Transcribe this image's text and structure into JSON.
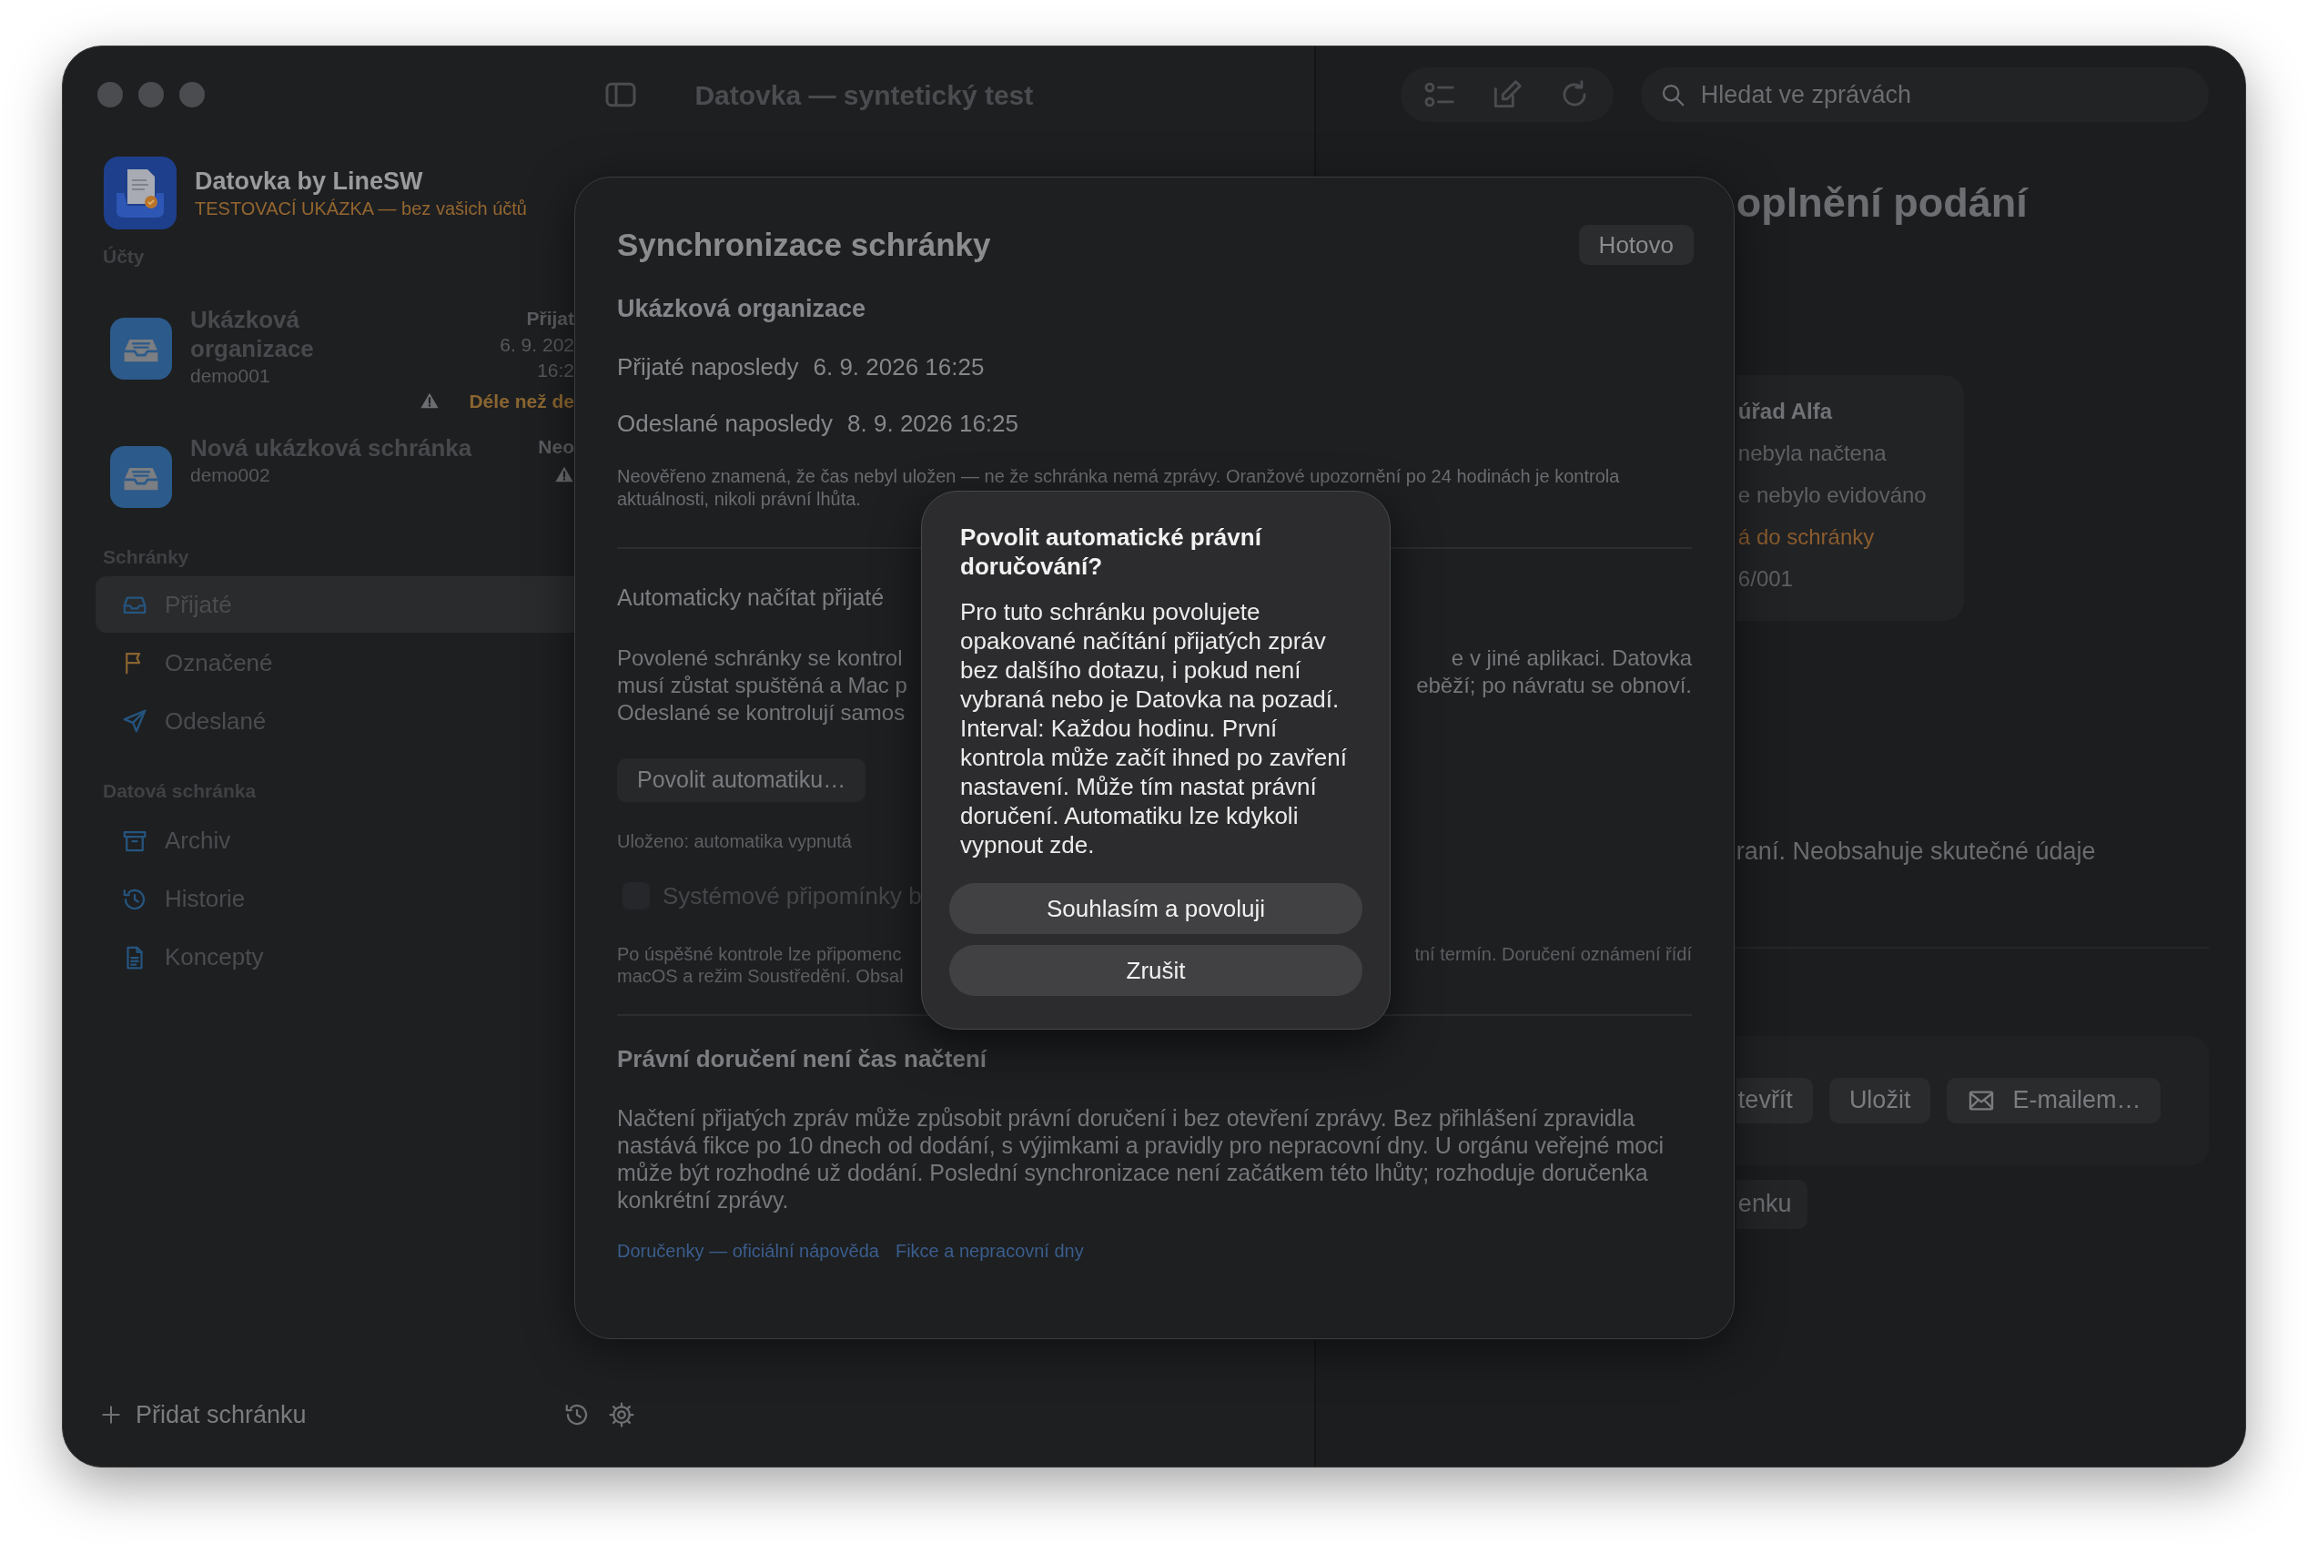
{
  "window": {
    "title": "Datovka — syntetický test"
  },
  "sidebar": {
    "app_name": "Datovka by LineSW",
    "app_subtitle": "TESTOVACÍ UKÁZKA — bez vašich účtů",
    "accounts_heading": "Účty",
    "accounts": [
      {
        "name": "Ukázková organizace",
        "box_id": "demo001",
        "status": [
          "Přijat",
          "6. 9. 202",
          "16:2"
        ],
        "warning": true,
        "warning_text": "Déle než de"
      },
      {
        "name": "Nová ukázková schránka",
        "box_id": "demo002",
        "status": [
          "Neo"
        ],
        "warning": true
      }
    ],
    "sections": [
      {
        "heading": "Schránky",
        "items": [
          {
            "label": "Přijaté",
            "selected": true
          },
          {
            "label": "Označené",
            "selected": false
          },
          {
            "label": "Odeslané",
            "selected": false
          }
        ]
      },
      {
        "heading": "Datová schránka",
        "items": [
          {
            "label": "Archiv",
            "selected": false
          },
          {
            "label": "Historie",
            "selected": false
          },
          {
            "label": "Koncepty",
            "selected": false
          }
        ]
      }
    ],
    "add_button": "Přidat schránku"
  },
  "search": {
    "placeholder": "Hledat ve zprávách"
  },
  "detail": {
    "heading": "oplnění podání",
    "card_lines": [
      {
        "text": "úřad Alfa",
        "kind": "title"
      },
      {
        "text": "nebyla načtena",
        "kind": "plain"
      },
      {
        "text": "e nebylo evidováno",
        "kind": "plain"
      },
      {
        "text": "á do schránky",
        "kind": "warning"
      },
      {
        "text": "6/001",
        "kind": "plain"
      }
    ],
    "note": "raní. Neobsahuje skutečné údaje",
    "actions": [
      "tevřít",
      "Uložit",
      "E-mailem…"
    ],
    "extra_action": "enku"
  },
  "sheet": {
    "title": "Synchronizace schránky",
    "done_button": "Hotovo",
    "account": "Ukázková organizace",
    "rows": [
      {
        "label": "Přijaté naposledy",
        "value": "6. 9. 2026 16:25"
      },
      {
        "label": "Odeslané naposledy",
        "value": "8. 9. 2026 16:25"
      }
    ],
    "note": "Neověřeno znamená, že čas nebyl uložen — ne že schránka nemá zprávy. Oranžové upozornění po 24 hodinách je kontrola aktuálnosti, nikoli právní lhůta.",
    "auto_heading": "Automaticky načítat přijaté",
    "auto_lines": [
      {
        "left": "Povolené schránky se kontrol",
        "right": "e v jiné aplikaci. Datovka"
      },
      {
        "left": "musí zůstat spuštěná a Mac p",
        "right": "eběží; po návratu se obnoví."
      },
      {
        "left": "Odeslané se kontrolují samos"
      }
    ],
    "enable_button": "Povolit automatiku…",
    "saved_status": "Uloženo: automatika vypnutá",
    "reminder": {
      "label": "Systémové připomínky b",
      "checked": false
    },
    "reminder_lines": [
      {
        "left": "Po úspěšné kontrole lze připomenc",
        "right": "tní termín. Doručení oznámení řídí"
      },
      {
        "left": "macOS a režim Soustředění. Obsal"
      }
    ],
    "legal_heading": "Právní doručení není čas načtení",
    "legal_text": "Načtení přijatých zpráv může způsobit právní doručení i bez otevření zprávy. Bez přihlášení zpravidla nastává fikce po 10 dnech od dodání, s výjimkami a pravidly pro nepracovní dny. U orgánu veřejné moci může být rozhodné už dodání. Poslední synchronizace není začátkem této lhůty; rozhoduje doručenka konkrétní zprávy.",
    "links": [
      "Doručenky — oficiální nápověda",
      "Fikce a nepracovní dny"
    ]
  },
  "alert": {
    "title": "Povolit automatické právní doručování?",
    "message": "Pro tuto schránku povolujete opakované načítání přijatých zpráv bez dalšího dotazu, i pokud není vybraná nebo je Datovka na pozadí. Interval: Každou hodinu. První kontrola může začít ihned po zavření nastavení. Může tím nastat právní doručení. Automatiku lze kdykoli vypnout zde.",
    "buttons": [
      "Souhlasím a povoluji",
      "Zrušit"
    ]
  }
}
